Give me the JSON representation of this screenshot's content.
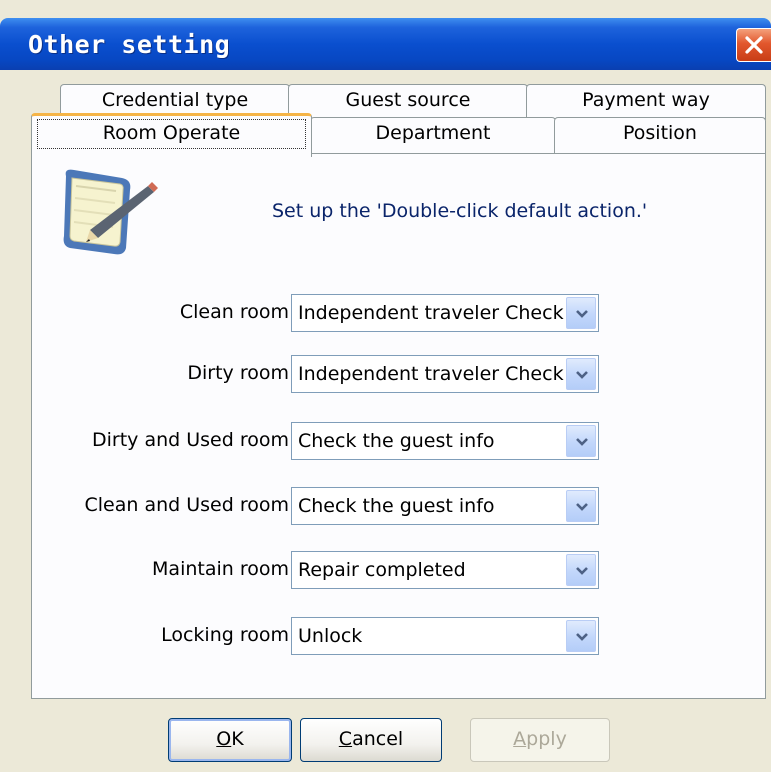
{
  "window": {
    "title": "Other setting",
    "close_icon": "close-x-icon"
  },
  "tabs": {
    "back_row": [
      {
        "label": "Credential type"
      },
      {
        "label": "Guest source"
      },
      {
        "label": "Payment way"
      }
    ],
    "front_row": [
      {
        "label": "Room Operate",
        "selected": true
      },
      {
        "label": "Department"
      },
      {
        "label": "Position"
      }
    ]
  },
  "panel": {
    "icon": "notepad-pencil-icon",
    "instruction": "Set up the 'Double-click default action.'",
    "fields": [
      {
        "label": "Clean room",
        "value": "Independent traveler Check"
      },
      {
        "label": "Dirty room",
        "value": "Independent traveler Check"
      },
      {
        "label": "Dirty and Used room",
        "value": "Check the guest info"
      },
      {
        "label": "Clean and Used room",
        "value": "Check the guest info"
      },
      {
        "label": "Maintain room",
        "value": "Repair completed"
      },
      {
        "label": "Locking room",
        "value": "Unlock"
      }
    ]
  },
  "buttons": {
    "ok": {
      "accel": "O",
      "rest": "K"
    },
    "cancel": {
      "accel": "C",
      "rest": "ancel"
    },
    "apply": {
      "accel": "A",
      "rest": "pply",
      "enabled": false
    }
  },
  "colors": {
    "titlebar": "#0a4fcf",
    "instruction_text": "#0a246a",
    "selected_tab_accent": "#f5b447",
    "close_button": "#e2572d"
  }
}
